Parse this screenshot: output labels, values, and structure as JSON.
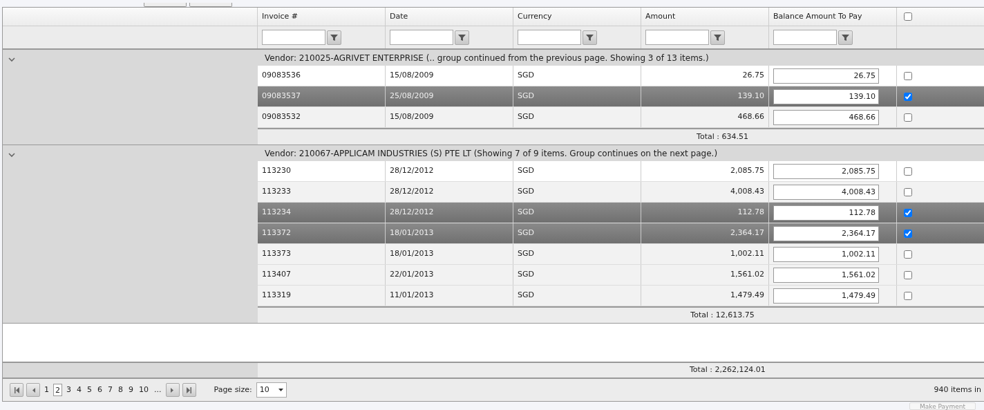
{
  "columns": [
    {
      "label": "Invoice #"
    },
    {
      "label": "Date"
    },
    {
      "label": "Currency"
    },
    {
      "label": "Amount"
    },
    {
      "label": "Balance Amount To Pay"
    }
  ],
  "select_all": {
    "checked": false
  },
  "groups": [
    {
      "header": "Vendor: 210025-AGRIVET ENTERPRISE (.. group continued from the previous page. Showing 3 of 13 items.)",
      "expanded": true,
      "total": "Total : 634.51",
      "rows": [
        {
          "invoice": "09083536",
          "date": "15/08/2009",
          "currency": "SGD",
          "amount": "26.75",
          "balance": "26.75",
          "selected": false,
          "checked": false
        },
        {
          "invoice": "09083537",
          "date": "25/08/2009",
          "currency": "SGD",
          "amount": "139.10",
          "balance": "139.10",
          "selected": true,
          "checked": true
        },
        {
          "invoice": "09083532",
          "date": "15/08/2009",
          "currency": "SGD",
          "amount": "468.66",
          "balance": "468.66",
          "selected": false,
          "checked": false
        }
      ]
    },
    {
      "header": "Vendor: 210067-APPLICAM INDUSTRIES (S) PTE LT (Showing 7 of 9 items. Group continues on the next page.)",
      "expanded": true,
      "total": "Total : 12,613.75",
      "rows": [
        {
          "invoice": "113230",
          "date": "28/12/2012",
          "currency": "SGD",
          "amount": "2,085.75",
          "balance": "2,085.75",
          "selected": false,
          "checked": false
        },
        {
          "invoice": "113233",
          "date": "28/12/2012",
          "currency": "SGD",
          "amount": "4,008.43",
          "balance": "4,008.43",
          "selected": false,
          "checked": false
        },
        {
          "invoice": "113234",
          "date": "28/12/2012",
          "currency": "SGD",
          "amount": "112.78",
          "balance": "112.78",
          "selected": true,
          "checked": true
        },
        {
          "invoice": "113372",
          "date": "18/01/2013",
          "currency": "SGD",
          "amount": "2,364.17",
          "balance": "2,364.17",
          "selected": true,
          "checked": true
        },
        {
          "invoice": "113373",
          "date": "18/01/2013",
          "currency": "SGD",
          "amount": "1,002.11",
          "balance": "1,002.11",
          "selected": false,
          "checked": false
        },
        {
          "invoice": "113407",
          "date": "22/01/2013",
          "currency": "SGD",
          "amount": "1,561.02",
          "balance": "1,561.02",
          "selected": false,
          "checked": false
        },
        {
          "invoice": "113319",
          "date": "11/01/2013",
          "currency": "SGD",
          "amount": "1,479.49",
          "balance": "1,479.49",
          "selected": false,
          "checked": false
        }
      ]
    }
  ],
  "grand_total": "Total : 2,262,124.01",
  "pager": {
    "pages": [
      {
        "label": "1",
        "selected": false
      },
      {
        "label": "2",
        "selected": true
      },
      {
        "label": "3",
        "selected": false
      },
      {
        "label": "4",
        "selected": false
      },
      {
        "label": "5",
        "selected": false
      },
      {
        "label": "6",
        "selected": false
      },
      {
        "label": "7",
        "selected": false
      },
      {
        "label": "8",
        "selected": false
      },
      {
        "label": "9",
        "selected": false
      },
      {
        "label": "10",
        "selected": false
      },
      {
        "label": "...",
        "selected": false
      }
    ],
    "page_size_label": "Page size:",
    "page_size": "10",
    "items_info": "940 items in"
  },
  "make_payment": {
    "label": "Make Payment",
    "disabled": true
  }
}
